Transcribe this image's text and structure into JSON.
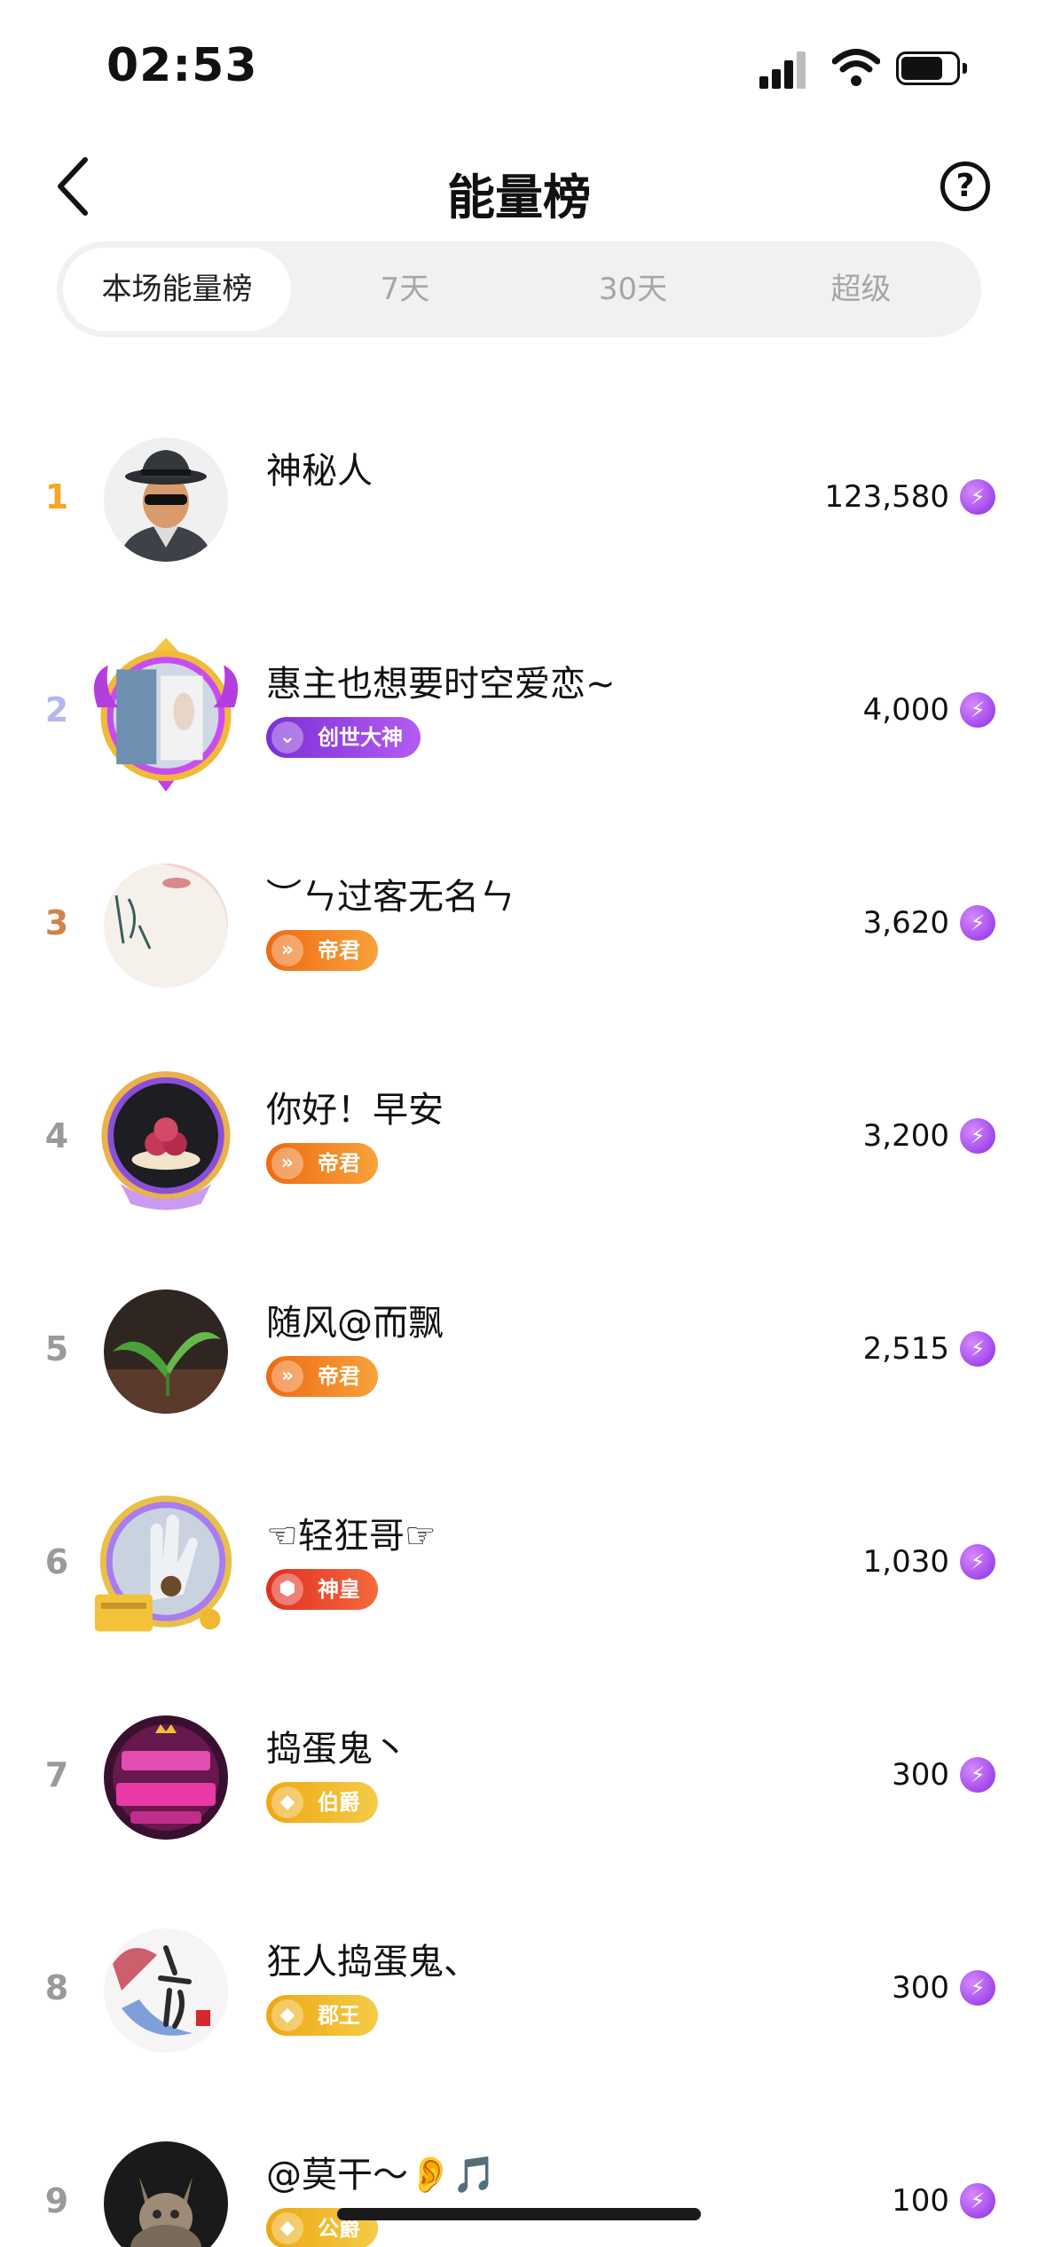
{
  "status_bar": {
    "time": "02:53"
  },
  "header": {
    "title": "能量榜",
    "help_label": "?"
  },
  "tabs": [
    {
      "label": "本场能量榜",
      "active": true
    },
    {
      "label": "7天",
      "active": false
    },
    {
      "label": "30天",
      "active": false
    },
    {
      "label": "超级",
      "active": false
    }
  ],
  "energy_icon_glyph": "⚡",
  "ranking": [
    {
      "rank": "1",
      "name": "神秘人",
      "score": "123,580",
      "badge": "",
      "rank_color": "#f5a623",
      "avatar": "mystery-man"
    },
    {
      "rank": "2",
      "name": "惠主也想要时空爱恋~",
      "score": "4,000",
      "badge": "创世大神",
      "badge_color": "#9b3fe0",
      "rank_color": "#b5b6f0",
      "avatar": "photo-window"
    },
    {
      "rank": "3",
      "name": "︶ㄣ过客无名ㄣ",
      "score": "3,620",
      "badge": "帝君",
      "badge_color": "#f07a1a",
      "rank_color": "#d0844a",
      "avatar": "face-calligraphy"
    },
    {
      "rank": "4",
      "name": "你好！早安",
      "score": "3,200",
      "badge": "帝君",
      "badge_color": "#f07a1a",
      "rank_color": "#9a9a9a",
      "avatar": "dessert"
    },
    {
      "rank": "5",
      "name": "随风@而飘",
      "score": "2,515",
      "badge": "帝君",
      "badge_color": "#f07a1a",
      "rank_color": "#9a9a9a",
      "avatar": "green-sprout"
    },
    {
      "rank": "6",
      "name": "☜轻狂哥☞",
      "score": "1,030",
      "badge": "神皇",
      "badge_color": "#e8382a",
      "rank_color": "#9a9a9a",
      "avatar": "hand-sculpture"
    },
    {
      "rank": "7",
      "name": "捣蛋鬼丶",
      "score": "300",
      "badge": "伯爵",
      "badge_color": "#f2b81c",
      "rank_color": "#9a9a9a",
      "avatar": "neon-text"
    },
    {
      "rank": "8",
      "name": "狂人捣蛋鬼、",
      "score": "300",
      "badge": "郡王",
      "badge_color": "#f2b81c",
      "rank_color": "#9a9a9a",
      "avatar": "calligraphy-art"
    },
    {
      "rank": "9",
      "name": "@莫干～👂🎵",
      "score": "100",
      "badge": "公爵",
      "badge_color": "#f2b81c",
      "rank_color": "#9a9a9a",
      "avatar": "cat"
    }
  ]
}
